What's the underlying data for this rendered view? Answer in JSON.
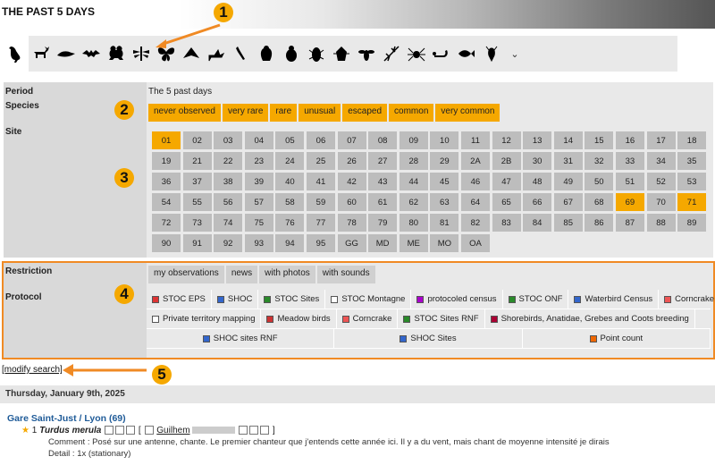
{
  "header": {
    "title": "THE PAST 5 DAYS"
  },
  "taxa": [
    "bird-icon",
    "deer-icon",
    "dolphin-icon",
    "bat-icon",
    "frog-icon",
    "dragonfly-icon",
    "butterfly-icon",
    "moth-icon",
    "grasshopper-icon",
    "mantis-icon",
    "cicada-icon",
    "beetle-icon",
    "cockroach-icon",
    "bug-icon",
    "fly-icon",
    "stick-insect-icon",
    "spider-icon",
    "scorpion-icon",
    "fish-icon",
    "crustacean-icon"
  ],
  "filters": {
    "period_label": "Period",
    "period_value": "The 5 past days",
    "species_label": "Species",
    "species": [
      "never observed",
      "very rare",
      "rare",
      "unusual",
      "escaped",
      "common",
      "very common"
    ],
    "site_label": "Site",
    "sites": [
      "01",
      "02",
      "03",
      "04",
      "05",
      "06",
      "07",
      "08",
      "09",
      "10",
      "11",
      "12",
      "13",
      "14",
      "15",
      "16",
      "17",
      "18",
      "19",
      "21",
      "22",
      "23",
      "24",
      "25",
      "26",
      "27",
      "28",
      "29",
      "2A",
      "2B",
      "30",
      "31",
      "32",
      "33",
      "34",
      "35",
      "36",
      "37",
      "38",
      "39",
      "40",
      "41",
      "42",
      "43",
      "44",
      "45",
      "46",
      "47",
      "48",
      "49",
      "50",
      "51",
      "52",
      "53",
      "54",
      "55",
      "56",
      "57",
      "58",
      "59",
      "60",
      "61",
      "62",
      "63",
      "64",
      "65",
      "66",
      "67",
      "68",
      "69",
      "70",
      "71",
      "72",
      "73",
      "74",
      "75",
      "76",
      "77",
      "78",
      "79",
      "80",
      "81",
      "82",
      "83",
      "84",
      "85",
      "86",
      "87",
      "88",
      "89",
      "90",
      "91",
      "92",
      "93",
      "94",
      "95",
      "GG",
      "MD",
      "ME",
      "MO",
      "OA"
    ],
    "sites_selected": [
      "01",
      "69",
      "71"
    ],
    "restriction_label": "Restriction",
    "restrictions": [
      "my observations",
      "news",
      "with photos",
      "with sounds"
    ],
    "protocol_label": "Protocol",
    "protocol_rows": [
      [
        {
          "label": "STOC EPS",
          "color": "#d33"
        },
        {
          "label": "SHOC",
          "color": "#36c"
        },
        {
          "label": "STOC Sites",
          "color": "#2a8a2a"
        },
        {
          "label": "STOC Montagne",
          "color": "#fff"
        },
        {
          "label": "protocoled census",
          "color": "#a0c"
        },
        {
          "label": "STOC ONF",
          "color": "#2a8a2a"
        },
        {
          "label": "Waterbird Census",
          "color": "#36c"
        },
        {
          "label": "Corncrake",
          "color": "#e55"
        }
      ],
      [
        {
          "label": "Private territory mapping",
          "color": "#fff"
        },
        {
          "label": "Meadow birds",
          "color": "#c33"
        },
        {
          "label": "Corncrake",
          "color": "#e55"
        },
        {
          "label": "STOC Sites RNF",
          "color": "#2a8a2a"
        },
        {
          "label": "Shorebirds, Anatidae, Grebes and Coots breeding",
          "color": "#a03"
        }
      ],
      [
        {
          "label": "SHOC sites RNF",
          "color": "#36c"
        },
        {
          "label": "SHOC Sites",
          "color": "#36c"
        },
        {
          "label": "Point count",
          "color": "#e60"
        }
      ]
    ]
  },
  "modify_search": "[modify search]",
  "date_heading": "Thursday, January 9th, 2025",
  "observation": {
    "location": "Gare Saint-Just / Lyon (69)",
    "count": "1",
    "species": "Turdus merula",
    "observer": "Guilhem",
    "comment": "Comment : Posé sur une antenne, chante. Le premier chanteur que j'entends cette année ici. Il y a du vent, mais chant de moyenne intensité je dirais",
    "detail": "Detail : 1x (stationary)"
  },
  "annotations": [
    "1",
    "2",
    "3",
    "4",
    "5"
  ],
  "colors": {
    "accent": "#f5a800",
    "highlight_border": "#f08a24",
    "link": "#1f5b98"
  }
}
